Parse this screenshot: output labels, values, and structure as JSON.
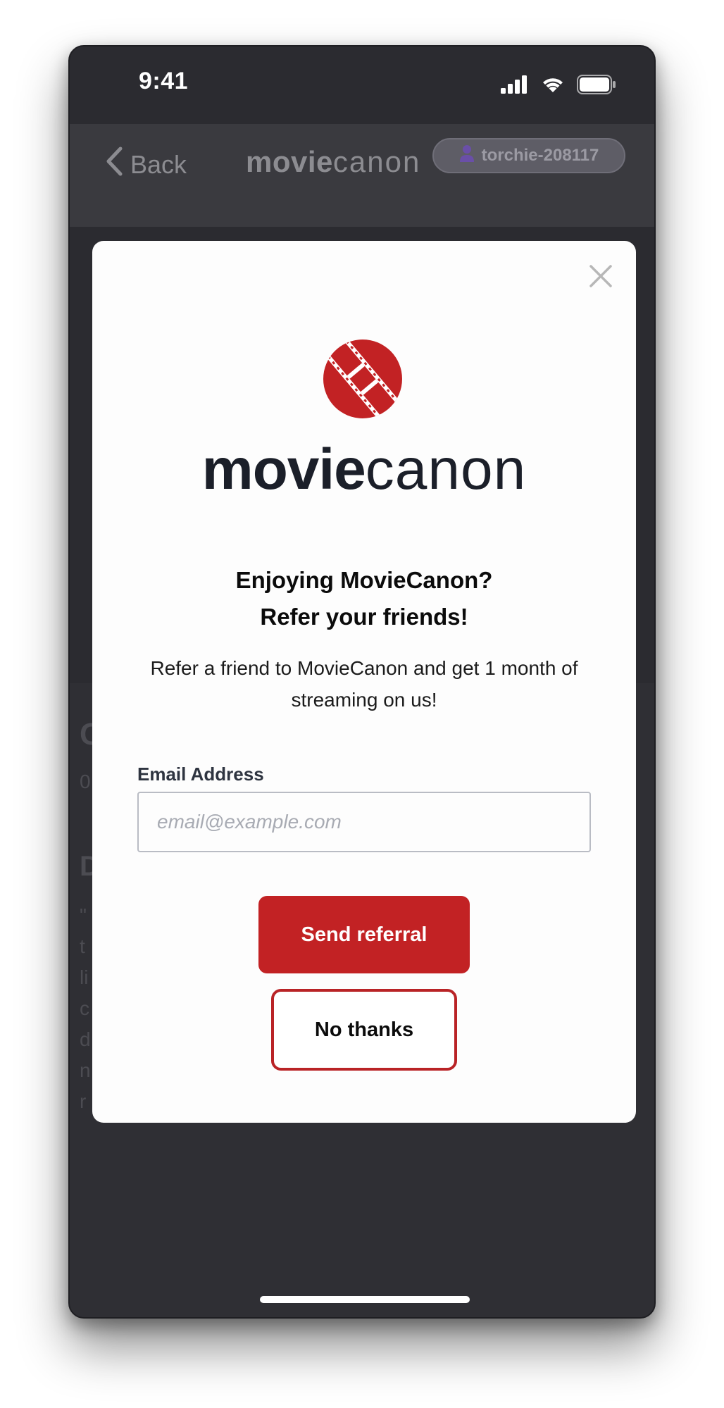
{
  "status_bar": {
    "time": "9:41"
  },
  "nav": {
    "back_label": "Back",
    "logo_bold": "movie",
    "logo_light": "canon",
    "username": "torchie-208117"
  },
  "background": {
    "detail_fragments": [
      "C",
      "0",
      "D",
      "\"",
      "t",
      "li",
      "c",
      "d",
      "n",
      "r"
    ]
  },
  "modal": {
    "brand_bold": "movie",
    "brand_light": "canon",
    "title_line1": "Enjoying MovieCanon?",
    "title_line2": "Refer your friends!",
    "description": "Refer a friend to MovieCanon and get 1 month of streaming on us!",
    "email_label": "Email Address",
    "email_placeholder": "email@example.com",
    "email_value": "",
    "send_button": "Send referral",
    "no_thanks_button": "No thanks"
  },
  "colors": {
    "brand_red": "#c22224",
    "phone_background": "#2b2b30",
    "modal_background": "#fdfdfd",
    "wordmark": "#1b1f29"
  },
  "icons": {
    "close": "close-icon",
    "back": "chevron-left-icon",
    "user": "user-icon",
    "logo": "film-reel-logo",
    "signal": "cellular-signal-icon",
    "wifi": "wifi-icon",
    "battery": "battery-icon"
  }
}
